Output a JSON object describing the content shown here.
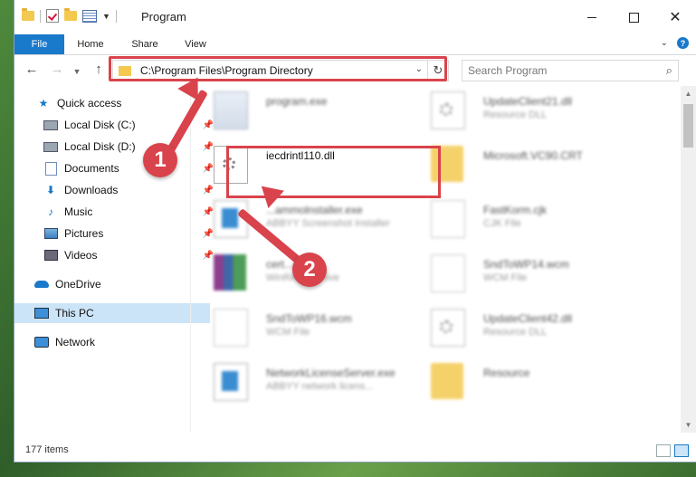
{
  "window": {
    "title": "Program",
    "tabs": {
      "file": "File",
      "home": "Home",
      "share": "Share",
      "view": "View"
    }
  },
  "nav": {
    "address": "C:\\Program Files\\Program Directory",
    "search_placeholder": "Search Program"
  },
  "sidebar": {
    "items": [
      {
        "label": "Quick access",
        "icon": "star-icon"
      },
      {
        "label": "Local Disk (C:)",
        "icon": "disk-icon",
        "pinned": true
      },
      {
        "label": "Local Disk (D:)",
        "icon": "disk-icon",
        "pinned": true
      },
      {
        "label": "Documents",
        "icon": "documents-icon",
        "pinned": true
      },
      {
        "label": "Downloads",
        "icon": "downloads-icon",
        "pinned": true
      },
      {
        "label": "Music",
        "icon": "music-icon",
        "pinned": true
      },
      {
        "label": "Pictures",
        "icon": "pictures-icon",
        "pinned": true
      },
      {
        "label": "Videos",
        "icon": "videos-icon",
        "pinned": true
      },
      {
        "label": "OneDrive",
        "icon": "cloud-icon"
      },
      {
        "label": "This PC",
        "icon": "pc-icon",
        "selected": true
      },
      {
        "label": "Network",
        "icon": "network-icon"
      }
    ]
  },
  "files": [
    {
      "name": "program.exe",
      "desc": "",
      "icon": "exe"
    },
    {
      "name": "UpdateClient21.dll",
      "desc": "Resource DLL",
      "icon": "dll"
    },
    {
      "name": "iecdrintl110.dll",
      "desc": "",
      "icon": "dll"
    },
    {
      "name": "Microsoft.VC90.CRT",
      "desc": "",
      "icon": "folder"
    },
    {
      "name": "...ammolnstaller.exe",
      "desc": "ABBYY Screenshot Installer",
      "icon": "win"
    },
    {
      "name": "FastKorm.cjk",
      "desc": "CJK File",
      "icon": "doc"
    },
    {
      "name": "cert...cab",
      "desc": "WinRAR archive",
      "icon": "rar"
    },
    {
      "name": "SndToWP14.wcm",
      "desc": "WCM File",
      "icon": "doc"
    },
    {
      "name": "SndToWP16.wcm",
      "desc": "WCM File",
      "icon": "doc"
    },
    {
      "name": "UpdateClient42.dll",
      "desc": "Resource DLL",
      "icon": "dll"
    },
    {
      "name": "NetworkLicenseServer.exe",
      "desc": "ABBYY network licens...",
      "icon": "win"
    },
    {
      "name": "Resource",
      "desc": "",
      "icon": "folder"
    }
  ],
  "status": {
    "items_count": "177 items"
  },
  "annotations": {
    "step1": "1",
    "step2": "2",
    "color": "#d9434b"
  },
  "colors": {
    "accent": "#1979ca",
    "selected_bg": "#cce4f7"
  }
}
